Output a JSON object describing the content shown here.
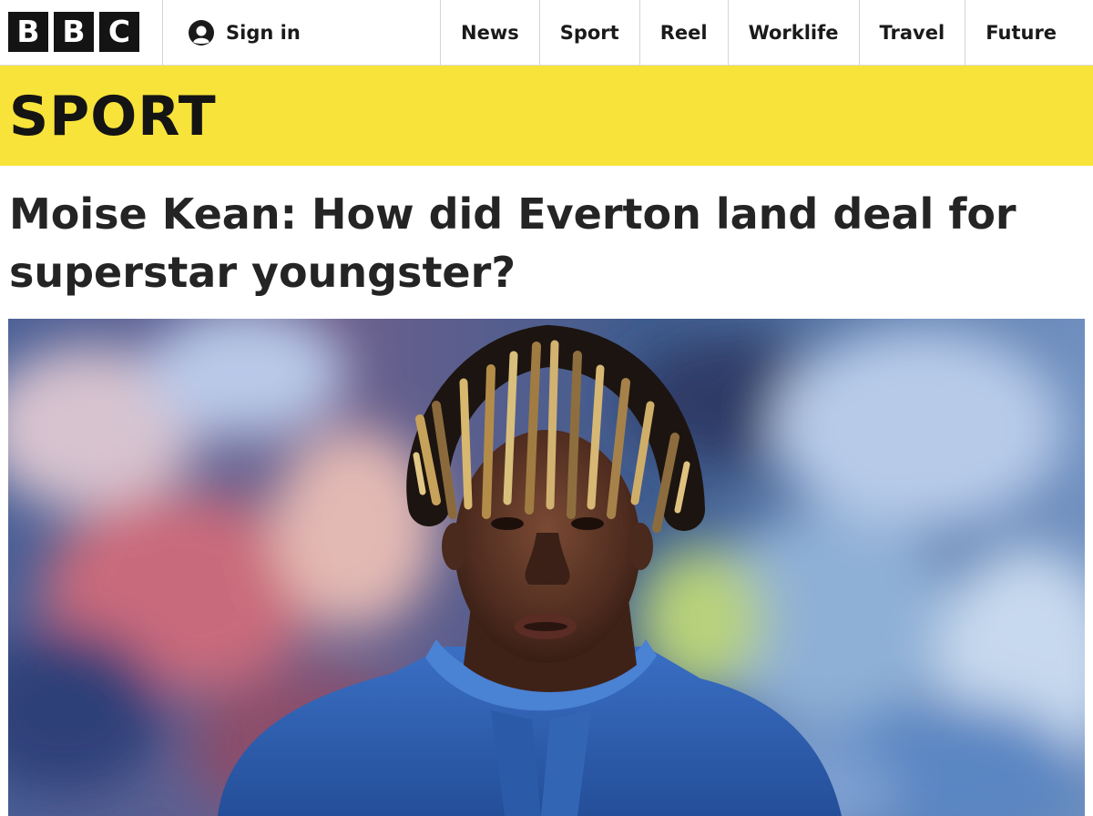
{
  "brand": {
    "letters": [
      "B",
      "B",
      "C"
    ]
  },
  "signin": {
    "icon": "user-icon",
    "label": "Sign in"
  },
  "nav": {
    "items": [
      "News",
      "Sport",
      "Reel",
      "Worklife",
      "Travel",
      "Future"
    ]
  },
  "banner": {
    "title": "SPORT",
    "color": "#f8e33a"
  },
  "article": {
    "headline": "Moise Kean: How did Everton land deal for superstar youngster?"
  },
  "colors": {
    "text": "#141414",
    "logo_block": "#141414",
    "banner": "#f8e33a",
    "jersey": "#2f5fb3"
  }
}
